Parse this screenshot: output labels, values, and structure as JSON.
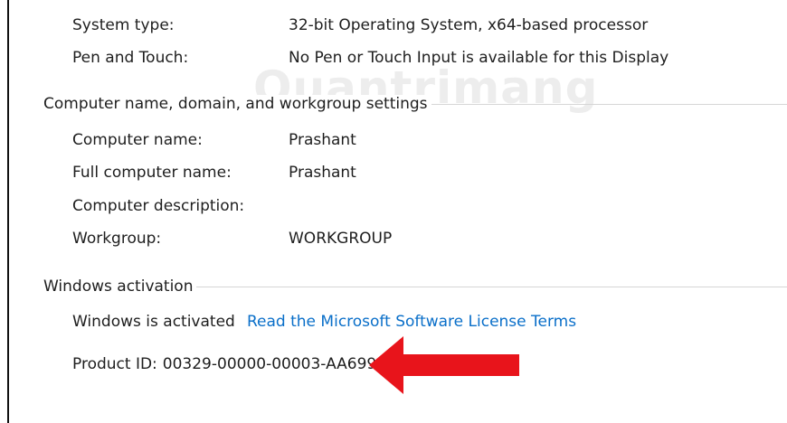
{
  "system": {
    "system_type_label": "System type:",
    "system_type_value": "32-bit Operating System, x64-based processor",
    "pen_touch_label": "Pen and Touch:",
    "pen_touch_value": "No Pen or Touch Input is available for this Display"
  },
  "computer_section": {
    "title": "Computer name, domain, and workgroup settings",
    "computer_name_label": "Computer name:",
    "computer_name_value": "Prashant",
    "full_name_label": "Full computer name:",
    "full_name_value": "Prashant",
    "description_label": "Computer description:",
    "description_value": "",
    "workgroup_label": "Workgroup:",
    "workgroup_value": "WORKGROUP"
  },
  "activation": {
    "title": "Windows activation",
    "status": "Windows is activated",
    "license_link": "Read the Microsoft Software License Terms",
    "product_id_label": "Product ID:",
    "product_id_value": "00329-00000-00003-AA699"
  },
  "watermark": {
    "text": "Quantrimang"
  },
  "colors": {
    "link": "#0a6fc9",
    "arrow": "#e8141b"
  }
}
